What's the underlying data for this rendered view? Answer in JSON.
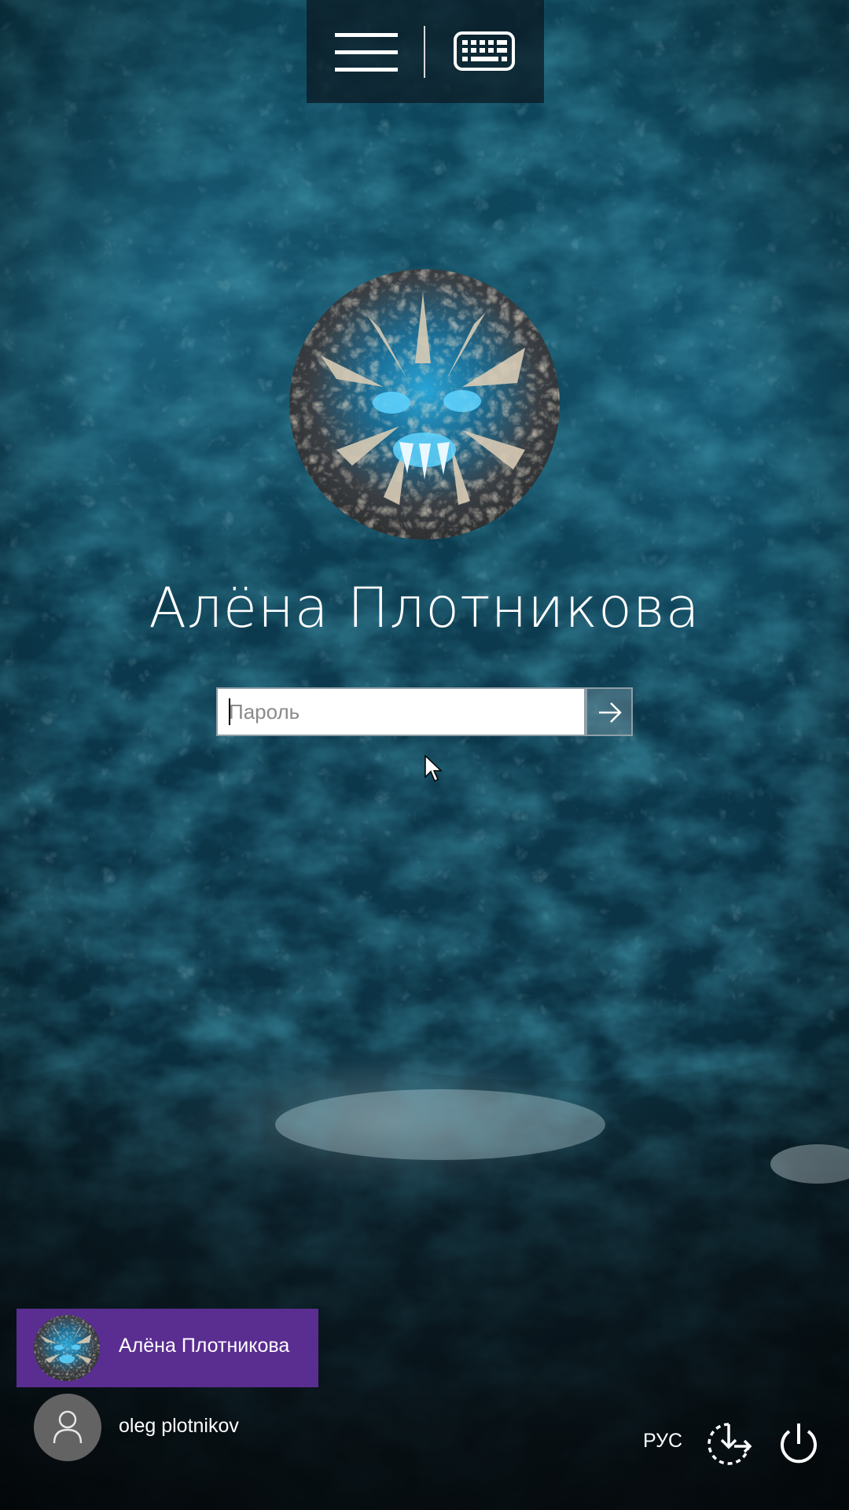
{
  "top_bar": {
    "menu_icon": "hamburger-menu-icon",
    "keyboard_icon": "keyboard-icon"
  },
  "login": {
    "user_name": "Алёна Плотникова",
    "password_placeholder": "Пароль",
    "password_value": "",
    "submit_icon": "arrow-right-icon"
  },
  "user_switcher": {
    "users": [
      {
        "name": "Алёна Плотникова",
        "selected": true,
        "avatar": "dragon-avatar"
      },
      {
        "name": "oleg plotnikov",
        "selected": false,
        "avatar": "generic-user-icon"
      }
    ]
  },
  "status_bar": {
    "language": "РУС",
    "accessibility_icon": "ease-of-access-icon",
    "power_icon": "power-icon"
  },
  "colors": {
    "selected_user_bg": "#5a2d91",
    "overlay_bar": "#0a161e",
    "generic_avatar_bg": "#636363"
  }
}
